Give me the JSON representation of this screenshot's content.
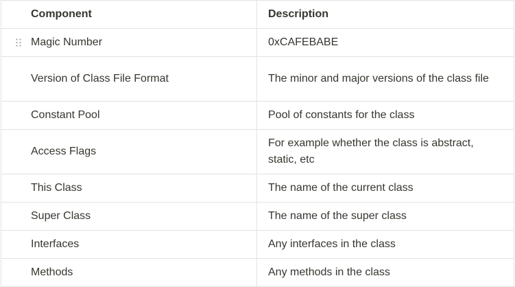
{
  "table": {
    "headers": {
      "component": "Component",
      "description": "Description"
    },
    "rows": [
      {
        "component": "Magic Number",
        "description": "0xCAFEBABE"
      },
      {
        "component": "Version of Class File Format",
        "description": "The minor and major versions of the class file"
      },
      {
        "component": "Constant Pool",
        "description": "Pool of constants for the class"
      },
      {
        "component": "Access Flags",
        "description": "For example whether the class is abstract, static, etc"
      },
      {
        "component": "This Class",
        "description": "The name of the current class"
      },
      {
        "component": "Super Class",
        "description": "The name of the super class"
      },
      {
        "component": "Interfaces",
        "description": "Any interfaces in the class"
      },
      {
        "component": "Methods",
        "description": "Any methods in the class"
      }
    ]
  },
  "icons": {
    "drag_handle": "drag-handle-icon"
  }
}
